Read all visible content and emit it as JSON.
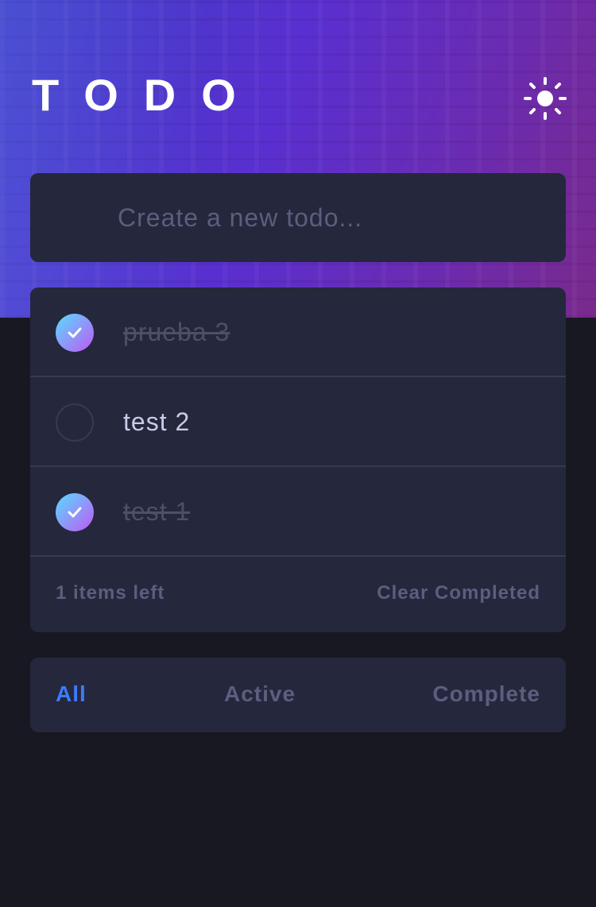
{
  "header": {
    "title": "TODO",
    "theme_toggle_icon": "sun-icon"
  },
  "new_todo": {
    "placeholder": "Create a new todo..."
  },
  "todos": [
    {
      "text": "prueba 3",
      "completed": true
    },
    {
      "text": "test 2",
      "completed": false
    },
    {
      "text": "test 1",
      "completed": true
    }
  ],
  "footer": {
    "items_left": "1 items left",
    "clear_label": "Clear Completed"
  },
  "filters": {
    "all": "All",
    "active": "Active",
    "complete": "Complete",
    "selected": "All"
  },
  "colors": {
    "accent": "#3a7cfd",
    "card": "#25273c",
    "background": "#171821",
    "check_gradient_start": "#57ddff",
    "check_gradient_end": "#c058f3"
  }
}
